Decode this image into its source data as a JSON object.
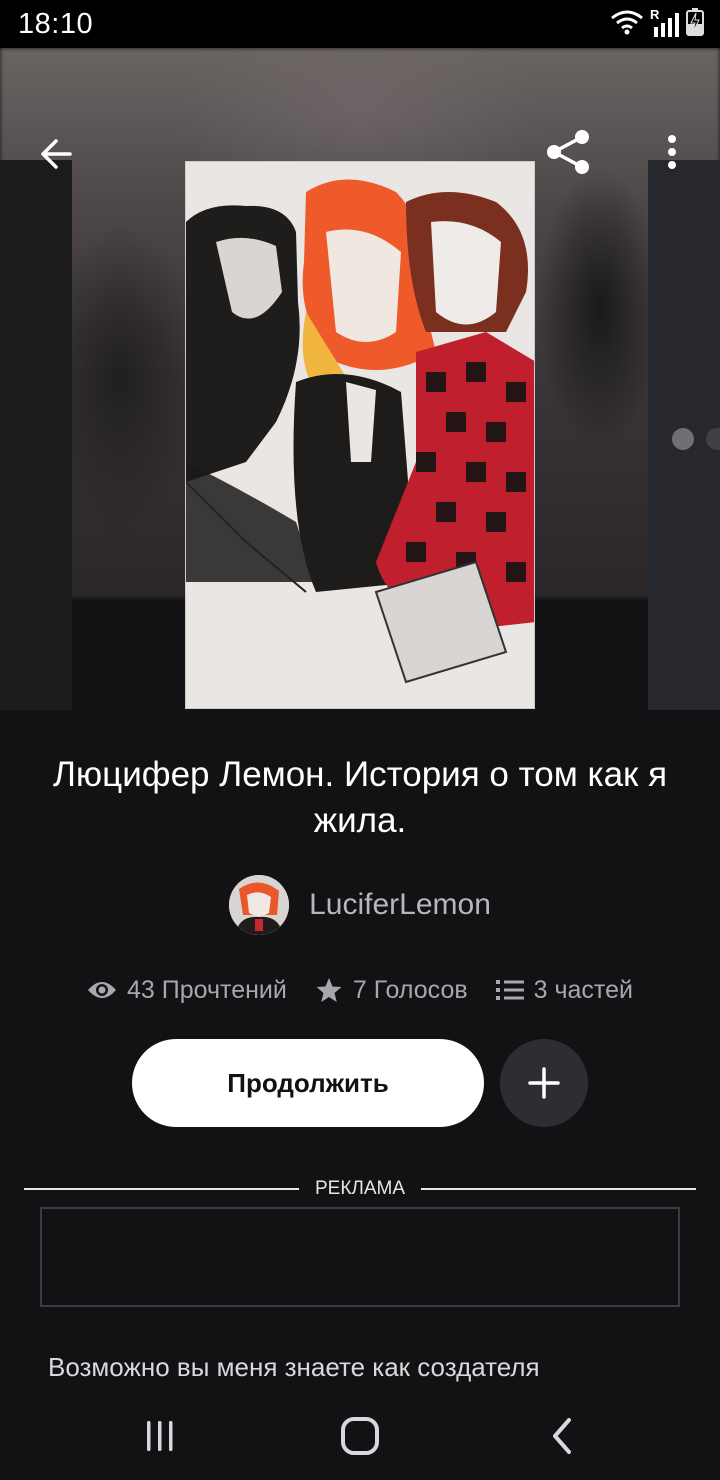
{
  "status_bar": {
    "time": "18:10",
    "icons": [
      "wifi-icon",
      "signal-icon",
      "battery-charging-icon"
    ],
    "signal_roaming": "R"
  },
  "toolbar": {
    "back_icon": "arrow-left-icon",
    "share_icon": "share-icon",
    "more_icon": "more-vertical-icon"
  },
  "story": {
    "title": "Люцифер Лемон. История о том как я жила.",
    "author": "LuciferLemon",
    "stats": {
      "reads": "43 Прочтений",
      "votes": "7 Голосов",
      "parts": "3 частей"
    },
    "continue_label": "Продолжить",
    "add_icon": "plus-icon",
    "description_preview": "Возможно вы меня знаете как создателя"
  },
  "ad": {
    "label": "РЕКЛАМА"
  },
  "nav_bar": {
    "icons": [
      "recents-icon",
      "home-icon",
      "back-icon"
    ]
  },
  "colors": {
    "background": "#121113",
    "button_primary": "#ffffff",
    "button_secondary": "#2e2d32",
    "muted_text": "#a9a7ac"
  }
}
